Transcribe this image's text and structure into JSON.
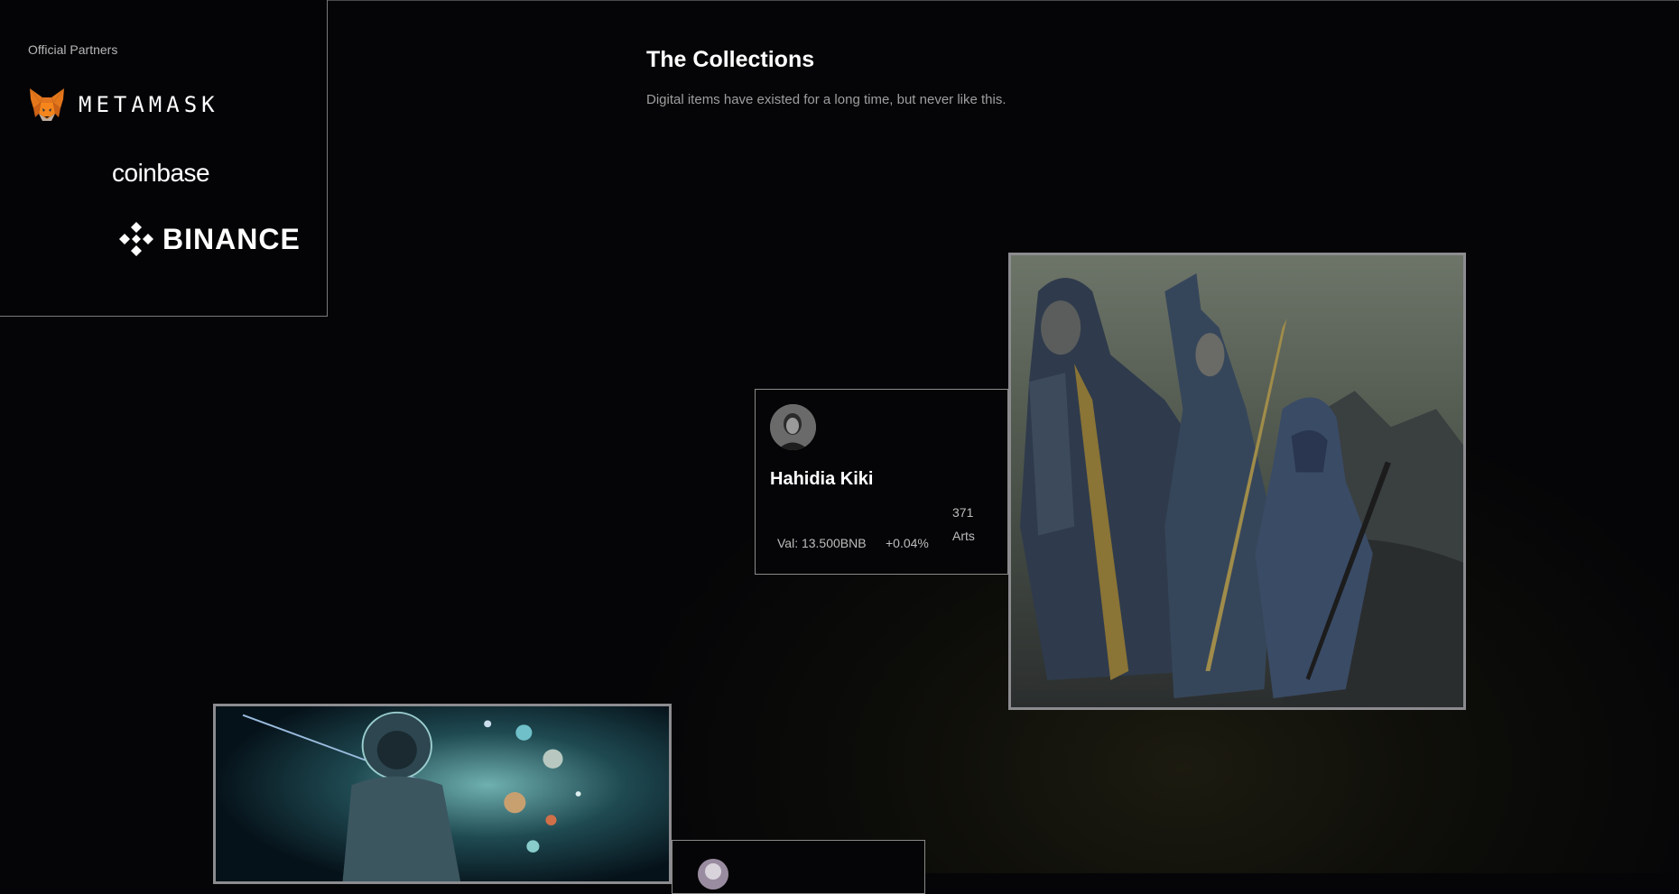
{
  "partners": {
    "title": "Official Partners",
    "items": [
      {
        "name": "METAMASK",
        "icon": "metamask-fox-icon"
      },
      {
        "name": "coinbase",
        "icon": ""
      },
      {
        "name": "BINANCE",
        "icon": "binance-diamond-icon"
      }
    ]
  },
  "collections": {
    "title": "The Collections",
    "subtitle": "Digital items have existed for a long time, but never like this."
  },
  "creator": {
    "name": "Hahidia Kiki",
    "value": "Val: 13.500BNB",
    "change": "+0.04%",
    "arts_count": "371",
    "arts_label": "Arts"
  },
  "colors": {
    "background": "#050507",
    "border": "#8a8a8a",
    "metamask_orange": "#e2761b",
    "glow": "#1c1b10"
  }
}
